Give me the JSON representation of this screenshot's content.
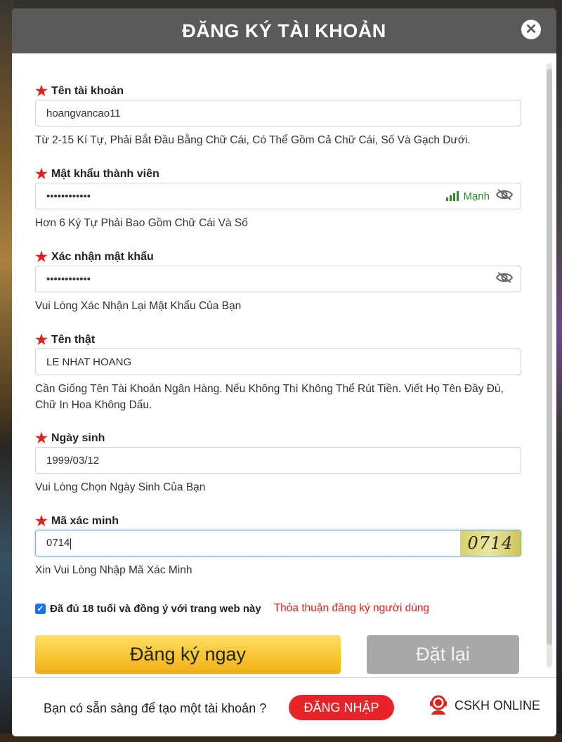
{
  "modal": {
    "title": "ĐĂNG KÝ TÀI KHOẢN",
    "close_icon": "close-icon"
  },
  "fields": {
    "username": {
      "label": "Tên tài khoản",
      "value": "hoangvancao11",
      "hint": "Từ 2-15 Kí Tự, Phải Bắt Đầu Bằng Chữ Cái, Có Thể Gồm Cả Chữ Cái, Số Và Gạch Dưới."
    },
    "password": {
      "label": "Mật khẩu thành viên",
      "value": "••••••••••••",
      "strength": "Mạnh",
      "hint": "Hơn 6 Ký Tự Phải Bao Gồm Chữ Cái Và Số"
    },
    "confirm_password": {
      "label": "Xác nhận mật khẩu",
      "value": "••••••••••••",
      "hint": "Vui Lòng Xác Nhận Lại Mật Khẩu Của Bạn"
    },
    "real_name": {
      "label": "Tên thật",
      "value": "LE NHAT HOANG",
      "hint": "Cần Giống Tên Tài Khoản Ngân Hàng. Nếu Không Thì Không Thể Rút Tiền. Viết Họ Tên Đầy Đủ, Chữ In Hoa Không Dấu."
    },
    "birthday": {
      "label": "Ngày sinh",
      "value": "1999/03/12",
      "hint": "Vui Lòng Chọn Ngày Sinh Của Bạn"
    },
    "captcha": {
      "label": "Mã xác minh",
      "value": "0714",
      "image_text": "0714",
      "hint": "Xin Vui Lòng Nhập Mã Xác Minh"
    }
  },
  "agreement": {
    "checked": true,
    "text": "Đã đủ 18 tuổi và đồng ý với trang web này",
    "link": "Thỏa thuận đăng ký người dùng"
  },
  "buttons": {
    "register": "Đăng ký ngay",
    "reset": "Đặt lại"
  },
  "footer": {
    "question": "Bạn có sẵn sàng để tạo một tài khoản ?",
    "login": "ĐĂNG NHẬP",
    "support": "CSKH ONLINE"
  },
  "colors": {
    "header_bg": "#5a5a5a",
    "required_star": "#e0201a",
    "strength_green": "#2e8b2e",
    "register_yellow": "#f9c531",
    "reset_gray": "#a8a8a8",
    "login_red": "#e8242a"
  }
}
